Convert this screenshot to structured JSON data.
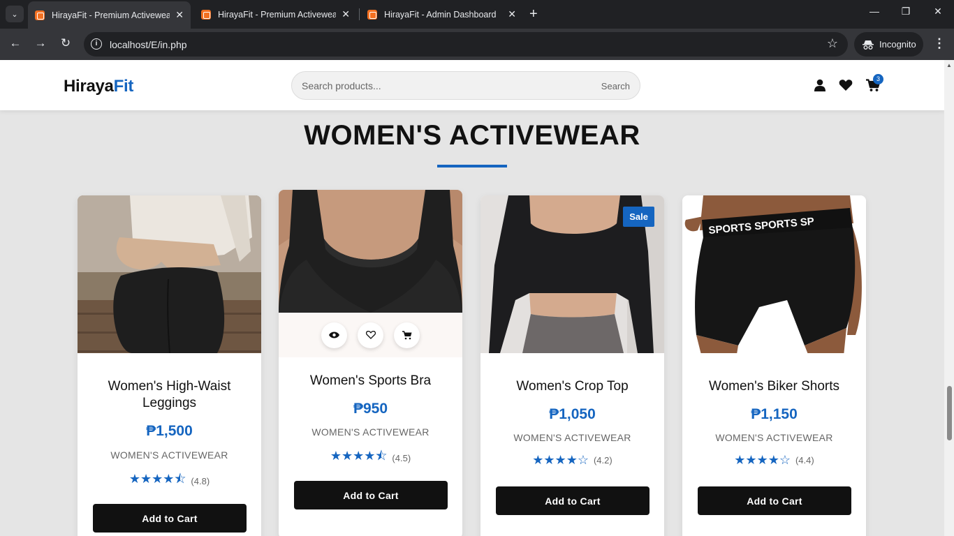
{
  "browser": {
    "tabs": [
      {
        "title": "HirayaFit - Premium Activewear",
        "active": true
      },
      {
        "title": "HirayaFit - Premium Activewear",
        "active": false
      },
      {
        "title": "HirayaFit - Admin Dashboard",
        "active": false
      }
    ],
    "url": "localhost/E/in.php",
    "profile_label": "Incognito"
  },
  "header": {
    "logo_main": "Hiraya",
    "logo_accent": "Fit",
    "search_placeholder": "Search products...",
    "search_button": "Search",
    "cart_count": "3"
  },
  "section": {
    "title": "WOMEN'S ACTIVEWEAR"
  },
  "products": [
    {
      "name": "Women's High-Waist Leggings",
      "price": "₱1,500",
      "category": "WOMEN'S ACTIVEWEAR",
      "stars": "★★★★⯪",
      "rating": "(4.8)",
      "button": "Add to Cart"
    },
    {
      "name": "Women's Sports Bra",
      "price": "₱950",
      "category": "WOMEN'S ACTIVEWEAR",
      "stars": "★★★★⯪",
      "rating": "(4.5)",
      "button": "Add to Cart"
    },
    {
      "name": "Women's Crop Top",
      "price": "₱1,050",
      "category": "WOMEN'S ACTIVEWEAR",
      "stars": "★★★★☆",
      "rating": "(4.2)",
      "badge": "Sale",
      "button": "Add to Cart"
    },
    {
      "name": "Women's Biker Shorts",
      "price": "₱1,150",
      "category": "WOMEN'S ACTIVEWEAR",
      "stars": "★★★★☆",
      "rating": "(4.4)",
      "button": "Add to Cart"
    }
  ],
  "product_image_text": {
    "biker_shorts_waistband": "SPORTS SPORTS SP"
  },
  "colors": {
    "accent": "#1565c0",
    "button": "#111111",
    "background": "#e5e5e5"
  }
}
